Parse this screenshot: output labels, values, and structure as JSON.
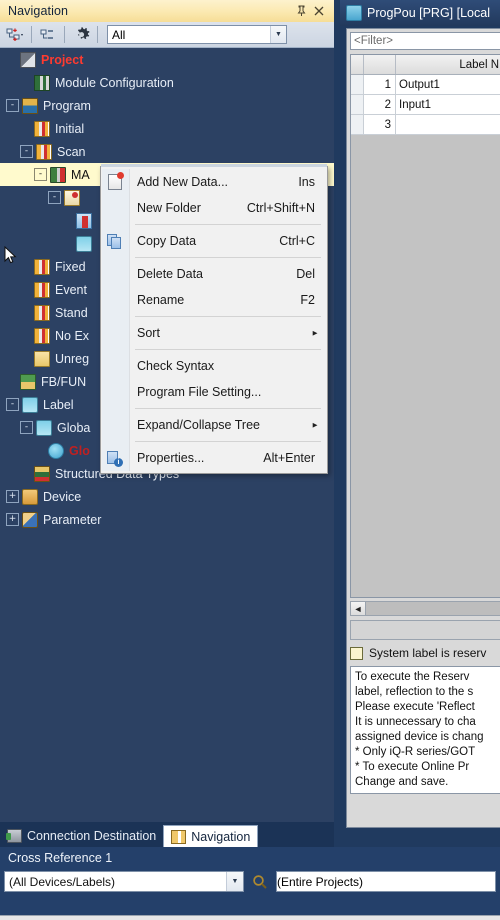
{
  "navigation": {
    "title": "Navigation",
    "pin_icon": "pin-icon",
    "close_icon": "close-icon",
    "toolbar": {
      "sort_icon": "tree-sort-icon",
      "collapse_icon": "tree-collapse-icon",
      "settings_icon": "gear-icon",
      "filter_value": "All",
      "filter_arrow_icon": "chevron-down-icon"
    },
    "tree": [
      {
        "label": "Project",
        "icon": "project-icon",
        "indent": 0,
        "expander": "",
        "style": "red",
        "selected": false
      },
      {
        "label": "Module Configuration",
        "icon": "module-icon",
        "indent": 1,
        "expander": "",
        "style": "",
        "selected": false
      },
      {
        "label": "Program",
        "icon": "program-icon",
        "indent": 0,
        "expander": "-",
        "style": "",
        "selected": false
      },
      {
        "label": "Initial",
        "icon": "books-icon",
        "indent": 1,
        "expander": "",
        "style": "",
        "selected": false
      },
      {
        "label": "Scan",
        "icon": "books-icon",
        "indent": 1,
        "expander": "-",
        "style": "",
        "selected": false
      },
      {
        "label": "MA",
        "icon": "ma-icon",
        "indent": 2,
        "expander": "-",
        "style": "",
        "selected": true
      },
      {
        "label": "",
        "icon": "file-icon",
        "indent": 3,
        "expander": "-",
        "style": "",
        "selected": false
      },
      {
        "label": "",
        "icon": "ladder-icon",
        "indent": 4,
        "expander": "",
        "style": "",
        "selected": false
      },
      {
        "label": "",
        "icon": "local-label-icon",
        "indent": 4,
        "expander": "",
        "style": "",
        "selected": false
      },
      {
        "label": "Fixed",
        "icon": "books-icon",
        "indent": 1,
        "expander": "",
        "style": "",
        "selected": false
      },
      {
        "label": "Event",
        "icon": "books-icon",
        "indent": 1,
        "expander": "",
        "style": "",
        "selected": false
      },
      {
        "label": "Stand",
        "icon": "books-icon",
        "indent": 1,
        "expander": "",
        "style": "",
        "selected": false
      },
      {
        "label": "No Ex",
        "icon": "books-icon",
        "indent": 1,
        "expander": "",
        "style": "",
        "selected": false
      },
      {
        "label": "Unreg",
        "icon": "folder-icon",
        "indent": 1,
        "expander": "",
        "style": "",
        "selected": false
      },
      {
        "label": "FB/FUN",
        "icon": "fb-fun-icon",
        "indent": 0,
        "expander": "",
        "style": "",
        "selected": false
      },
      {
        "label": "Label",
        "icon": "label-icon",
        "indent": 0,
        "expander": "-",
        "style": "",
        "selected": false
      },
      {
        "label": "Globa",
        "icon": "label-icon",
        "indent": 1,
        "expander": "-",
        "style": "",
        "selected": false
      },
      {
        "label": "Glo",
        "icon": "global-label-icon",
        "indent": 2,
        "expander": "",
        "style": "darkred",
        "selected": false
      },
      {
        "label": "Structured Data Types",
        "icon": "sdt-icon",
        "indent": 1,
        "expander": "",
        "style": "",
        "selected": false
      },
      {
        "label": "Device",
        "icon": "device-icon",
        "indent": 0,
        "expander": "+",
        "style": "",
        "selected": false
      },
      {
        "label": "Parameter",
        "icon": "parameter-icon",
        "indent": 0,
        "expander": "+",
        "style": "",
        "selected": false
      }
    ],
    "cursor_icon": "mouse-pointer-icon"
  },
  "context_menu": {
    "items": [
      {
        "label": "Add New Data...",
        "accel": "Ins",
        "icon": "new-data-icon",
        "submenu": false,
        "sep_after": false
      },
      {
        "label": "New Folder",
        "accel": "Ctrl+Shift+N",
        "icon": "",
        "submenu": false,
        "sep_after": true
      },
      {
        "label": "Copy Data",
        "accel": "Ctrl+C",
        "icon": "copy-icon",
        "submenu": false,
        "sep_after": true
      },
      {
        "label": "Delete Data",
        "accel": "Del",
        "icon": "",
        "submenu": false,
        "sep_after": false
      },
      {
        "label": "Rename",
        "accel": "F2",
        "icon": "",
        "submenu": false,
        "sep_after": true
      },
      {
        "label": "Sort",
        "accel": "",
        "icon": "",
        "submenu": true,
        "sep_after": true
      },
      {
        "label": "Check Syntax",
        "accel": "",
        "icon": "",
        "submenu": false,
        "sep_after": false
      },
      {
        "label": "Program File Setting...",
        "accel": "",
        "icon": "",
        "submenu": false,
        "sep_after": true
      },
      {
        "label": "Expand/Collapse Tree",
        "accel": "",
        "icon": "",
        "submenu": true,
        "sep_after": true
      },
      {
        "label": "Properties...",
        "accel": "Alt+Enter",
        "icon": "properties-icon",
        "submenu": false,
        "sep_after": false
      }
    ]
  },
  "editor": {
    "title": "ProgPou [PRG] [Local",
    "title_icon": "pou-icon",
    "filter_placeholder": "<Filter>",
    "grid": {
      "columns": [
        "",
        "",
        "Label N"
      ],
      "rows": [
        {
          "num": "1",
          "label": "Output1"
        },
        {
          "num": "2",
          "label": "Input1"
        },
        {
          "num": "3",
          "label": ""
        }
      ]
    },
    "hscroll_left_icon": "chevron-left-icon",
    "checkbox": {
      "label": "System label is reserv",
      "checked": false
    },
    "message_lines": [
      "To execute the Reserv",
      "label, reflection to the s",
      "Please execute 'Reflect",
      "It is unnecessary to cha",
      "assigned device is chang",
      "* Only iQ-R series/GOT",
      "* To execute Online Pr",
      "Change and save."
    ]
  },
  "bottom_tabs": [
    {
      "label": "Connection Destination",
      "icon": "connection-icon",
      "active": false
    },
    {
      "label": "Navigation",
      "icon": "navigation-icon",
      "active": true
    }
  ],
  "cross_reference": {
    "title": "Cross Reference 1",
    "device_filter": "(All Devices/Labels)",
    "device_filter_arrow_icon": "chevron-down-icon",
    "find_icon": "magnifier-icon",
    "scope": "(Entire Projects)"
  },
  "colors": {
    "panel_bg": "#2c4163",
    "title_gold": "#fbe9b0",
    "selection": "#fffacd",
    "accent_red": "#ff3b30",
    "menu_bg": "#f1f1f1"
  }
}
